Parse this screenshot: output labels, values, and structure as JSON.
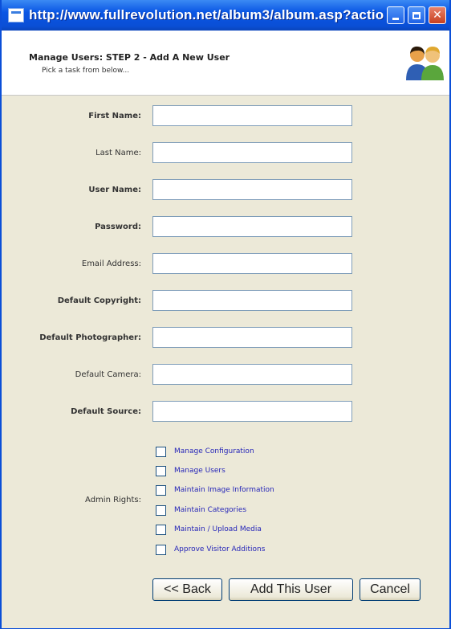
{
  "window": {
    "title": "http://www.fullrevolution.net/album3/album.asp?actio..."
  },
  "header": {
    "title": "Manage Users: STEP 2 - Add A New User",
    "subtitle": "Pick a task from below..."
  },
  "form": {
    "fields": [
      {
        "label": "First Name:",
        "value": ""
      },
      {
        "label": "Last Name:",
        "value": ""
      },
      {
        "label": "User Name:",
        "value": ""
      },
      {
        "label": "Password:",
        "value": ""
      },
      {
        "label": "Email Address:",
        "value": ""
      },
      {
        "label": "Default Copyright:",
        "value": ""
      },
      {
        "label": "Default Photographer:",
        "value": ""
      },
      {
        "label": "Default Camera:",
        "value": ""
      },
      {
        "label": "Default Source:",
        "value": ""
      }
    ],
    "admin_rights_label": "Admin Rights:",
    "admin_rights": [
      {
        "label": "Manage Configuration",
        "checked": false
      },
      {
        "label": "Manage Users",
        "checked": false
      },
      {
        "label": "Maintain Image Information",
        "checked": false
      },
      {
        "label": "Maintain Categories",
        "checked": false
      },
      {
        "label": "Maintain / Upload Media",
        "checked": false
      },
      {
        "label": "Approve Visitor Additions",
        "checked": false
      }
    ]
  },
  "buttons": {
    "back": "<< Back",
    "add": "Add This User",
    "cancel": "Cancel"
  }
}
